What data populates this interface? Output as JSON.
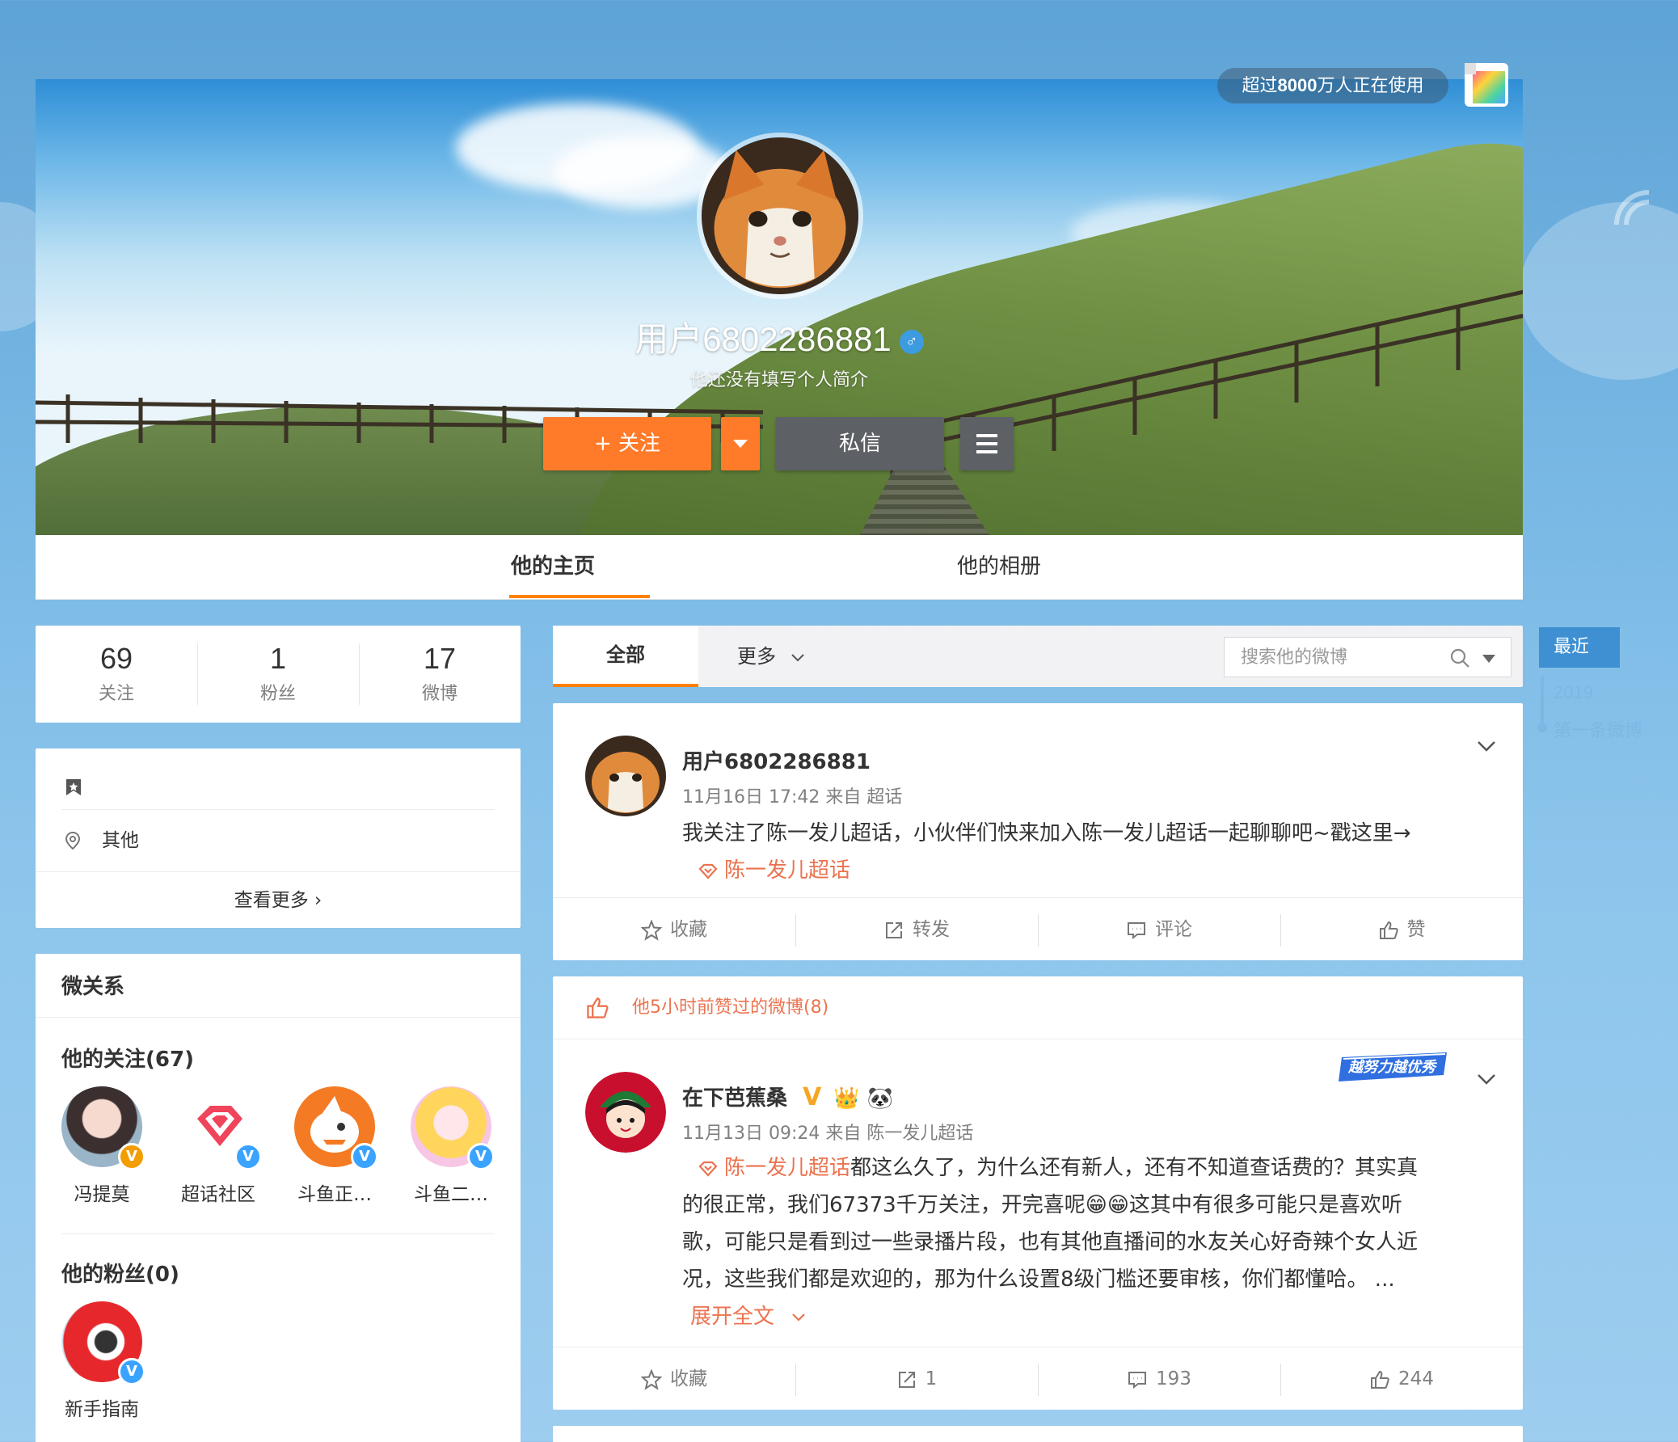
{
  "header": {
    "users_prefix": "超过",
    "users_count": "8000",
    "users_suffix": "万人正在使用",
    "profile_name": "用户6802286881",
    "gender_symbol": "♂",
    "intro": "他还没有填写个人简介",
    "follow_label": "+ 关注",
    "message_label": "私信"
  },
  "tabs": [
    "他的主页",
    "他的相册"
  ],
  "stats": [
    {
      "num": "69",
      "label": "关注"
    },
    {
      "num": "1",
      "label": "粉丝"
    },
    {
      "num": "17",
      "label": "微博"
    }
  ],
  "info": {
    "location": "其他",
    "view_more": "查看更多 ›"
  },
  "relations": {
    "title": "微关系",
    "following_title": "他的关注(67)",
    "following": [
      {
        "name": "冯提莫",
        "badge": "V",
        "badge_color": "#f29d00"
      },
      {
        "name": "超话社区",
        "badge": "V",
        "badge_color": "#3aa3ff"
      },
      {
        "name": "斗鱼正…",
        "badge": "V",
        "badge_color": "#3aa3ff"
      },
      {
        "name": "斗鱼二…",
        "badge": "V",
        "badge_color": "#3aa3ff"
      }
    ],
    "fans_title": "他的粉丝(0)",
    "fans": [
      {
        "name": "新手指南",
        "badge": "V",
        "badge_color": "#3aa3ff"
      }
    ]
  },
  "feed": {
    "tab_all": "全部",
    "tab_more": "更多",
    "search_placeholder": "搜索他的微博"
  },
  "post1": {
    "name": "用户6802286881",
    "meta": "11月16日 17:42 来自 超话",
    "text": "我关注了陈一发儿超话，小伙伴们快来加入陈一发儿超话一起聊聊吧~戳这里→",
    "link": "陈一发儿超话",
    "actions": [
      "收藏",
      "转发",
      "评论",
      "赞"
    ]
  },
  "post2": {
    "banner": "他5小时前赞过的微博(8)",
    "name": "在下芭蕉桑",
    "meta": "11月13日 09:24 来自 陈一发儿超话",
    "link": "陈一发儿超话",
    "text_line1": "都这么久了，为什么还有新人，还有不知道查话费的？其实真",
    "text_line2": "的很正常，我们67373千万关注，开完喜呢😁😁这其中有很多可能只是喜欢听",
    "text_line3": "歌，可能只是看到过一些录播片段，也有其他直播间的水友关心好奇辣个女人近",
    "text_line4": "况，这些我们都是欢迎的，那为什么设置8级门槛还要审核，你们都懂哈。 ...",
    "expand": "展开全文",
    "badge_text": "越努力越优秀",
    "actions": [
      "收藏",
      "1",
      "193",
      "244"
    ]
  },
  "timeline": {
    "recent": "最近",
    "year": "2019",
    "first": "第一条微博"
  }
}
